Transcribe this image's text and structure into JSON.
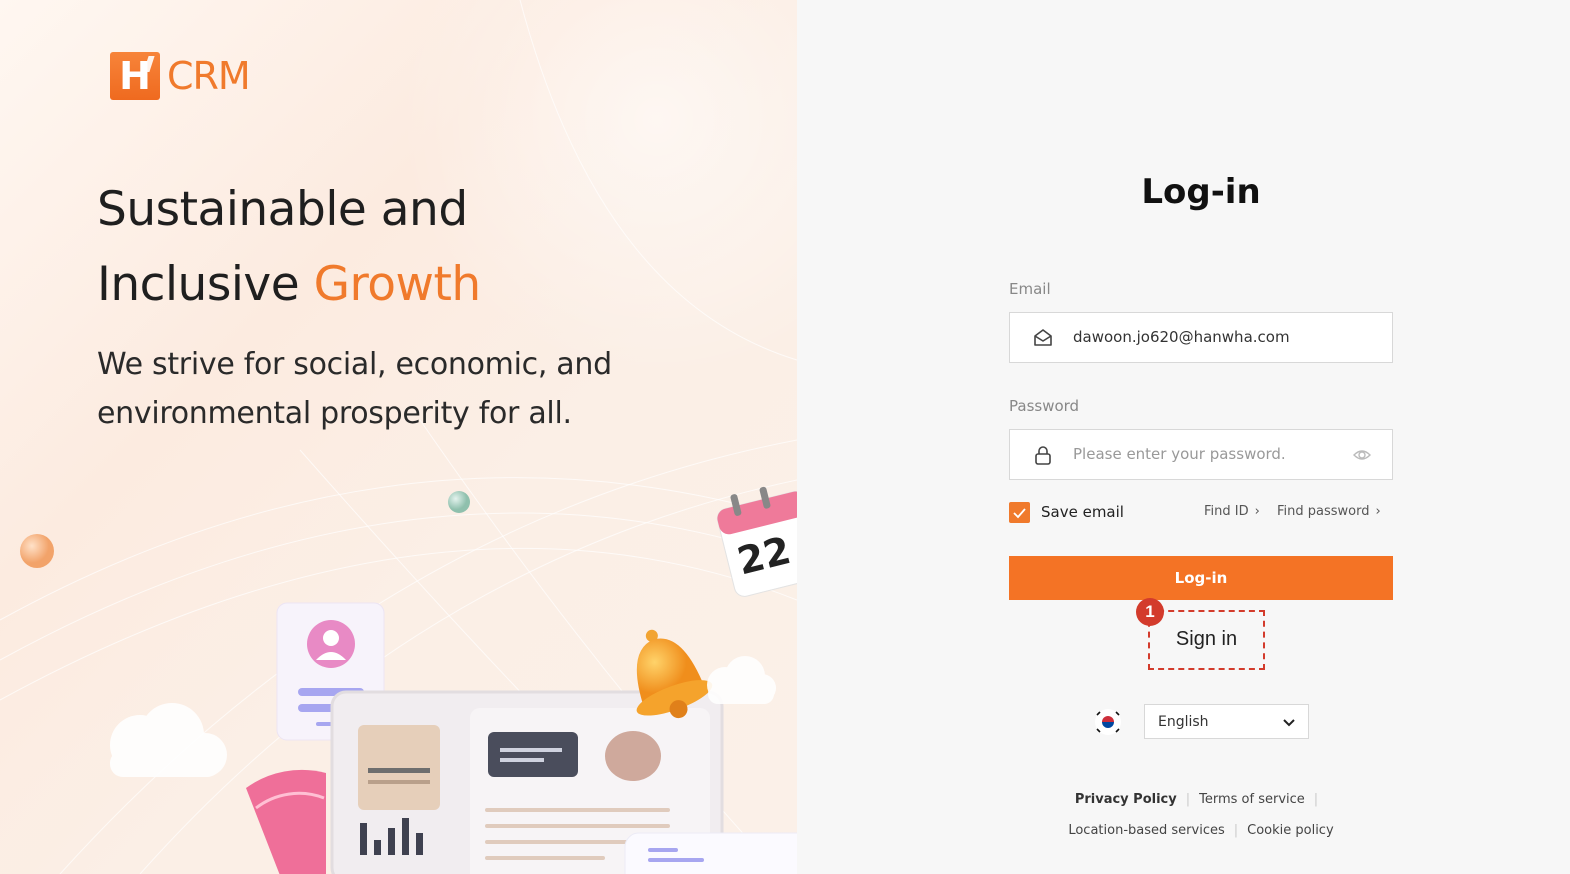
{
  "brand": {
    "logo_letter": "H",
    "logo_text": "CRM"
  },
  "hero": {
    "headline_line1": "Sustainable and",
    "headline_line2_plain": "Inclusive ",
    "headline_line2_accent": "Growth",
    "subline_line1": "We strive for social, economic, and",
    "subline_line2": "environmental prosperity for all.",
    "calendar_day": "22"
  },
  "login": {
    "title": "Log-in",
    "email_label": "Email",
    "email_value": "dawoon.jo620@hanwha.com",
    "password_label": "Password",
    "password_placeholder": "Please enter your password.",
    "save_email_label": "Save email",
    "save_email_checked": true,
    "find_id": "Find ID",
    "find_password": "Find password",
    "login_button": "Log-in",
    "signin_link": "Sign in",
    "annotation_number": "1"
  },
  "language": {
    "selected": "English"
  },
  "footer": {
    "privacy": "Privacy Policy",
    "terms": "Terms of service",
    "location": "Location-based services",
    "cookie": "Cookie policy"
  },
  "colors": {
    "accent": "#f07a2c",
    "button": "#f47325",
    "annotation": "#d33b2c"
  }
}
